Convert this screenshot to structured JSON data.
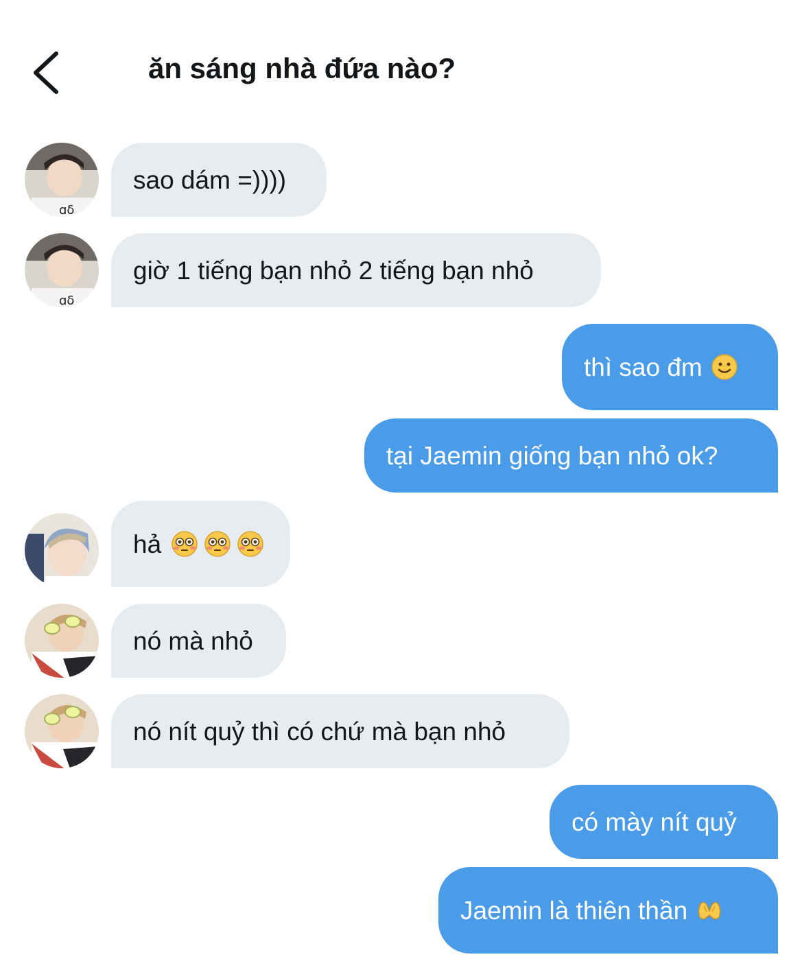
{
  "header": {
    "back_icon": "chevron-left-icon",
    "title": "ăn sáng nhà đứa nào?"
  },
  "messages": [
    {
      "side": "in",
      "avatar": "avatar-boy-white-shirt",
      "text": "sao dám =))))"
    },
    {
      "side": "in",
      "avatar": "avatar-boy-white-shirt",
      "text": "giờ 1 tiếng bạn nhỏ 2 tiếng bạn nhỏ"
    },
    {
      "side": "out",
      "text": "thì sao đm",
      "emoji": "slightly-smiling-face-icon"
    },
    {
      "side": "out",
      "text": "tại Jaemin giống bạn nhỏ ok?"
    },
    {
      "side": "in",
      "avatar": "avatar-boy-blue-hair",
      "text": "hả",
      "emoji": "flushed-face-icon x3"
    },
    {
      "side": "in",
      "avatar": "avatar-boy-sunglasses",
      "text": "nó mà nhỏ"
    },
    {
      "side": "in",
      "avatar": "avatar-boy-sunglasses",
      "text": "nó nít quỷ thì có chứ mà bạn nhỏ"
    },
    {
      "side": "out",
      "text": "có mày nít quỷ"
    },
    {
      "side": "out",
      "text": "Jaemin là thiên thần",
      "emoji": "heart-hands-icon"
    }
  ],
  "colors": {
    "incoming_bubble": "#e6ecf0",
    "outgoing_bubble": "#4a9be8",
    "text_dark": "#14171a"
  }
}
